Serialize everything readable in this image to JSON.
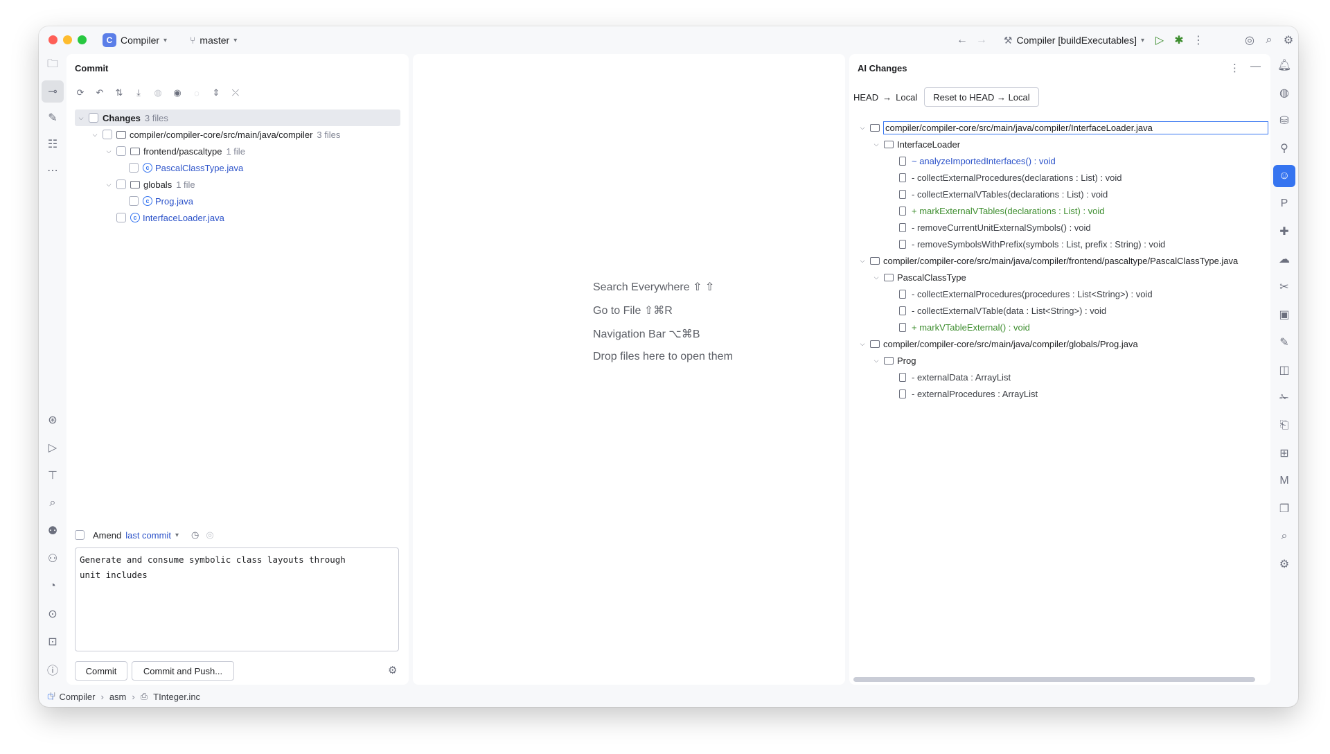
{
  "titlebar": {
    "project_badge": "C",
    "project": "Compiler",
    "branch": "master",
    "run_config": "Compiler [buildExecutables]"
  },
  "commit_panel": {
    "title": "Commit",
    "tree": {
      "changes_label": "Changes",
      "changes_count": "3 files",
      "module_path": "compiler/compiler-core/src/main/java/compiler",
      "module_count": "3 files",
      "folder1": "frontend/pascaltype",
      "folder1_count": "1 file",
      "file1": "PascalClassType.java",
      "folder2": "globals",
      "folder2_count": "1 file",
      "file2": "Prog.java",
      "file3": "InterfaceLoader.java"
    },
    "amend_label": "Amend",
    "last_commit": "last commit",
    "message": "Generate and consume symbolic class layouts through \nunit includes",
    "commit_btn": "Commit",
    "commit_push_btn": "Commit and Push..."
  },
  "editor": {
    "hints": [
      "Search Everywhere ⇧ ⇧",
      "Go to File ⇧⌘R",
      "Navigation Bar ⌥⌘B",
      "Drop files here to open them"
    ]
  },
  "ai_panel": {
    "title": "AI Changes",
    "head_label": "HEAD",
    "arrow": "→",
    "local_label": "Local",
    "reset_btn": "Reset to HEAD → Local",
    "files": [
      {
        "path": "compiler/compiler-core/src/main/java/compiler/InterfaceLoader.java",
        "class": "InterfaceLoader",
        "members": [
          {
            "text": "~ analyzeImportedInterfaces() : void",
            "kind": "modified"
          },
          {
            "text": "- collectExternalProcedures(declarations : List) : void",
            "kind": "removed"
          },
          {
            "text": "- collectExternalVTables(declarations : List) : void",
            "kind": "removed"
          },
          {
            "text": "+ markExternalVTables(declarations : List) : void",
            "kind": "added"
          },
          {
            "text": "- removeCurrentUnitExternalSymbols() : void",
            "kind": "removed"
          },
          {
            "text": "- removeSymbolsWithPrefix(symbols : List, prefix : String) : void",
            "kind": "removed"
          }
        ]
      },
      {
        "path": "compiler/compiler-core/src/main/java/compiler/frontend/pascaltype/PascalClassType.java",
        "class": "PascalClassType",
        "members": [
          {
            "text": "- collectExternalProcedures(procedures : List<String>) : void",
            "kind": "removed"
          },
          {
            "text": "- collectExternalVTable(data : List<String>) : void",
            "kind": "removed"
          },
          {
            "text": "+ markVTableExternal() : void",
            "kind": "added"
          }
        ]
      },
      {
        "path": "compiler/compiler-core/src/main/java/compiler/globals/Prog.java",
        "class": "Prog",
        "members": [
          {
            "text": "- externalData : ArrayList",
            "kind": "removed"
          },
          {
            "text": "- externalProcedures : ArrayList",
            "kind": "removed"
          }
        ]
      }
    ]
  },
  "statusbar": {
    "crumbs": [
      "Compiler",
      "asm",
      "TInteger.inc"
    ]
  },
  "colors": {
    "accent": "#3574f0",
    "added": "#3d8d2e",
    "modified": "#2b52c9"
  }
}
